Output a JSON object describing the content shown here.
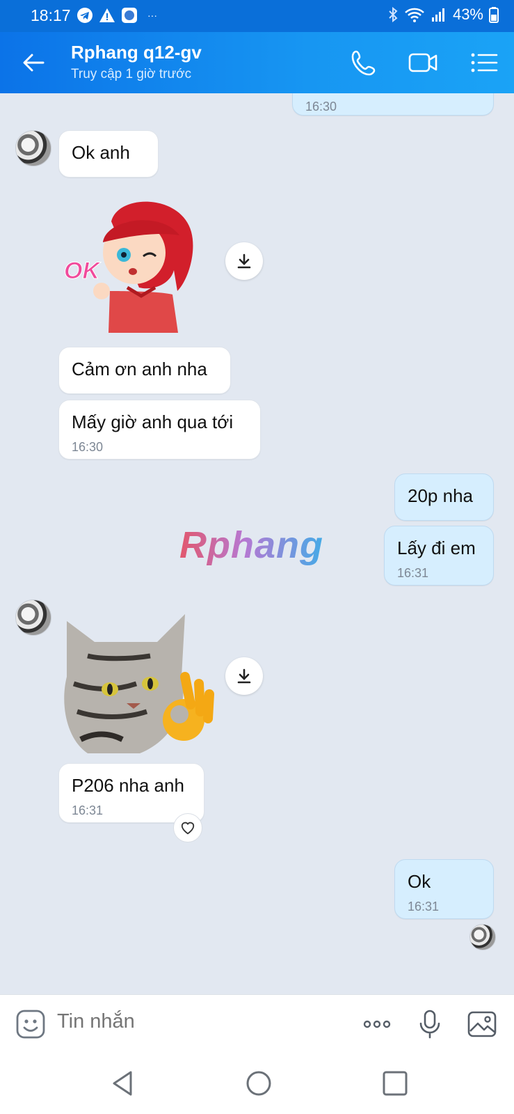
{
  "status_bar": {
    "time": "18:17",
    "more": "···",
    "battery": "43%"
  },
  "header": {
    "title": "Rphang q12-gv",
    "subtitle": "Truy cập 1 giờ trước"
  },
  "messages": [
    {
      "dir": "out",
      "text": "",
      "time": "16:30"
    },
    {
      "dir": "in",
      "text": "Ok anh",
      "time": ""
    },
    {
      "dir": "in",
      "sticker": "ok-girl-sticker"
    },
    {
      "dir": "in",
      "text": "Cảm ơn anh nha",
      "time": ""
    },
    {
      "dir": "in",
      "text": "Mấy giờ anh qua tới",
      "time": "16:30"
    },
    {
      "dir": "out",
      "text": "20p nha",
      "time": ""
    },
    {
      "dir": "out",
      "text": "Lấy đi em",
      "time": "16:31"
    },
    {
      "dir": "in",
      "sticker": "cat-ok-sticker"
    },
    {
      "dir": "in",
      "text": "P206 nha anh",
      "time": "16:31"
    },
    {
      "dir": "out",
      "text": "Ok",
      "time": "16:31"
    }
  ],
  "watermark": "Rphang",
  "input": {
    "placeholder": "Tin nhắn"
  },
  "colors": {
    "header": "#1796f2",
    "chat_bg": "#e2e8f1",
    "bubble_out": "#d6eefe",
    "bubble_in": "#ffffff"
  }
}
